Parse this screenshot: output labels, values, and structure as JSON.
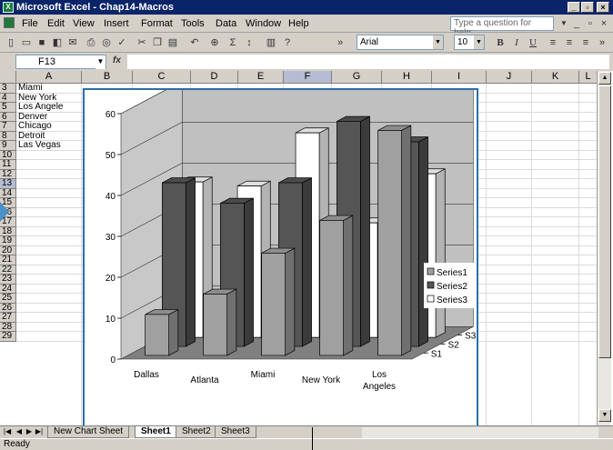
{
  "window": {
    "title": "Microsoft Excel - Chap14-Macros",
    "controls": [
      "_",
      "▫",
      "×"
    ]
  },
  "menu": {
    "items": [
      "File",
      "Edit",
      "View",
      "Insert",
      "Format",
      "Tools",
      "Data",
      "Window",
      "Help"
    ],
    "help_placeholder": "Type a question for help",
    "doc_controls": [
      "_",
      "▫",
      "×"
    ]
  },
  "toolbar": {
    "font": "Arial",
    "size": "10",
    "bold": "B",
    "italic": "I",
    "underline": "U"
  },
  "formula_bar": {
    "name_box": "F13",
    "fx": "fx",
    "content": ""
  },
  "grid": {
    "columns": [
      "A",
      "B",
      "C",
      "D",
      "E",
      "F",
      "G",
      "H",
      "I",
      "J",
      "K",
      "L"
    ],
    "rows": [
      "3",
      "4",
      "5",
      "6",
      "7",
      "8",
      "9",
      "10",
      "11",
      "12",
      "13",
      "14",
      "15",
      "16",
      "17",
      "18",
      "19",
      "20",
      "21",
      "22",
      "23",
      "24",
      "25",
      "26",
      "27",
      "28",
      "29"
    ],
    "cells_a": [
      "Miami",
      "New York",
      "Los Angele",
      "Denver",
      "Chicago",
      "Detroit",
      "Las Vegas"
    ]
  },
  "sheets": {
    "tabs": [
      "New Chart Sheet",
      "Sheet1",
      "Sheet2",
      "Sheet3"
    ],
    "active": "Sheet1"
  },
  "status": {
    "text": "Ready"
  },
  "chart_data": {
    "type": "bar",
    "subtype": "3d-column",
    "categories": [
      "Dallas",
      "Atlanta",
      "Miami",
      "New York",
      "Los Angeles"
    ],
    "series": [
      {
        "name": "Series1",
        "values": [
          10,
          15,
          25,
          33,
          55
        ],
        "color": "#a0a0a0"
      },
      {
        "name": "Series2",
        "values": [
          40,
          35,
          40,
          55,
          50
        ],
        "color": "#555555"
      },
      {
        "name": "Series3",
        "values": [
          38,
          37,
          50,
          28,
          40
        ],
        "color": "#ffffff"
      }
    ],
    "z_labels": [
      "S1",
      "S2",
      "S3"
    ],
    "y_ticks": [
      "0",
      "10",
      "20",
      "30",
      "40",
      "50",
      "60"
    ],
    "ylim": [
      0,
      60
    ],
    "legend": "right",
    "grid": true
  }
}
